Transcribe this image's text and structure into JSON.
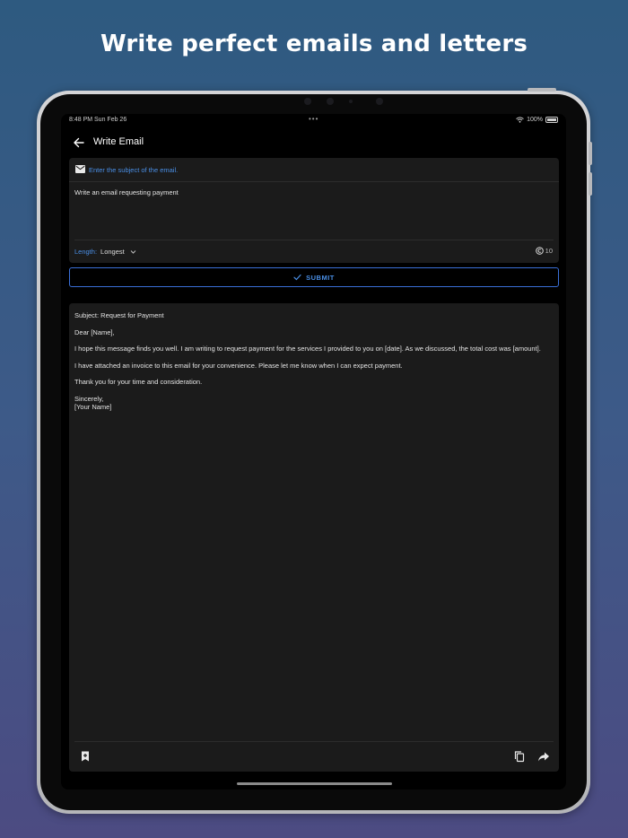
{
  "headline": "Write perfect emails and letters",
  "status_bar": {
    "time": "8:48 PM  Sun Feb 26",
    "dots": "•••",
    "battery": "100%"
  },
  "app_bar": {
    "title": "Write Email"
  },
  "form": {
    "subject_placeholder": "Enter the subject of the email.",
    "prompt": "Write an email requesting payment",
    "length_label": "Length:",
    "length_value": "Longest",
    "credits": "10"
  },
  "submit": {
    "label": "SUBMIT"
  },
  "output": {
    "subject_line": "Subject: Request for Payment",
    "greeting": "Dear [Name],",
    "paragraph_1": "I hope this message finds you well. I am writing to request payment for the services I provided to you on [date]. As we discussed, the total cost was [amount].",
    "paragraph_2": "I have attached an invoice to this email for your convenience. Please let me know when I can expect payment.",
    "paragraph_3": "Thank you for your time and consideration.",
    "closing": "Sincerely,",
    "signature": "[Your Name]"
  },
  "colors": {
    "accent": "#4a8fe6",
    "card": "#1b1b1b",
    "screen": "#000000"
  },
  "icons": [
    "back-arrow-icon",
    "mail-icon",
    "chevron-down-icon",
    "credits-icon",
    "check-icon",
    "bookmark-add-icon",
    "copy-icon",
    "share-icon",
    "wifi-icon",
    "battery-icon"
  ]
}
